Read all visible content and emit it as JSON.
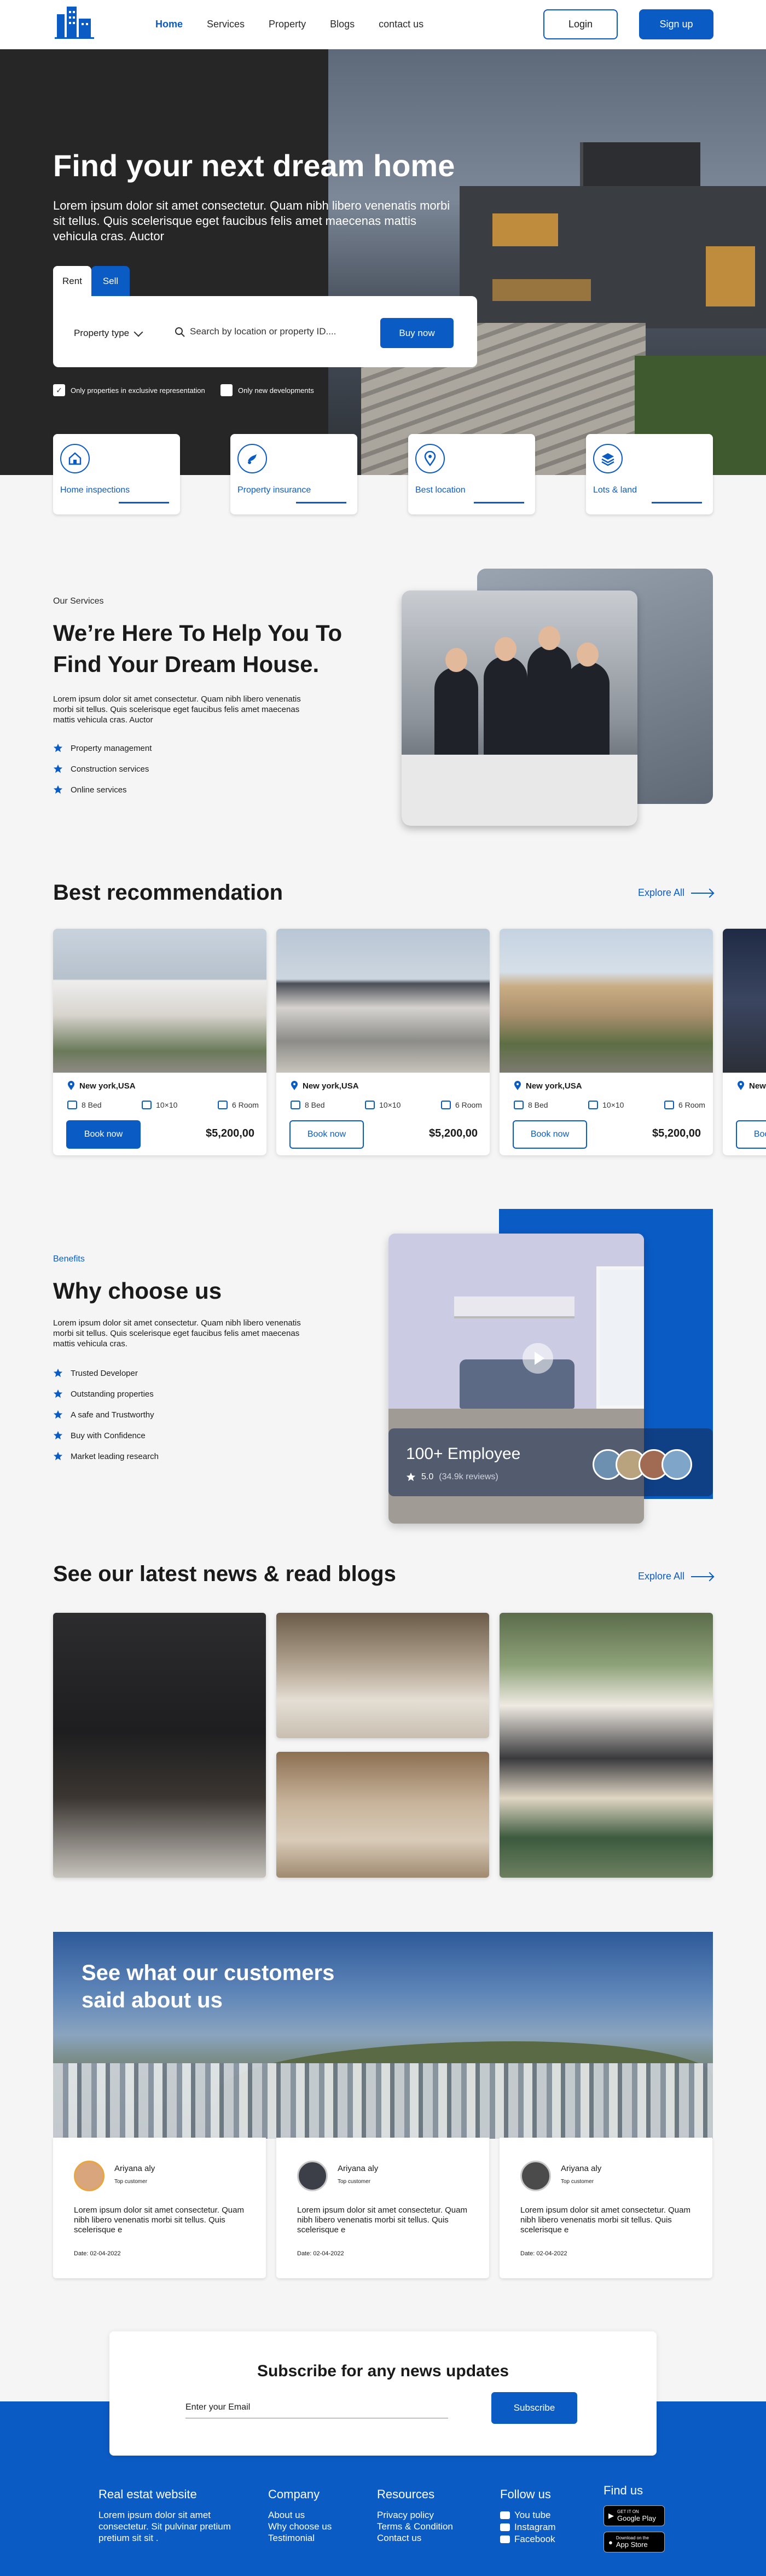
{
  "nav": {
    "links": [
      "Home",
      "Services",
      "Property",
      "Blogs",
      "contact us"
    ],
    "login": "Login",
    "signup": "Sign up"
  },
  "hero": {
    "title": "Find your next dream home",
    "subtitle": "Lorem ipsum dolor sit amet consectetur. Quam nibh libero venenatis morbi sit tellus. Quis scelerisque eget faucibus felis amet maecenas mattis vehicula cras. Auctor",
    "tabs": [
      "Rent",
      "Sell"
    ],
    "property_type": "Property type",
    "search_placeholder": "Search by location or property ID....",
    "buy_button": "Buy now",
    "checkbox_1": "Only properties in exclusive representation",
    "checkbox_2": "Only new developments"
  },
  "features": [
    "Home inspections",
    "Property insurance",
    "Best location",
    "Lots & land"
  ],
  "services": {
    "kicker": "Our Services",
    "title": "We’re Here To Help You To Find Your Dream House.",
    "text": "Lorem ipsum dolor sit amet consectetur. Quam nibh libero venenatis morbi sit tellus. Quis scelerisque eget faucibus felis amet maecenas mattis vehicula cras. Auctor",
    "items": [
      "Property management",
      "Construction services",
      "Online services"
    ]
  },
  "recommendation": {
    "title": "Best recommendation",
    "explore": "Explore All",
    "cards": [
      {
        "location": "New york,USA",
        "bed": "8 Bed",
        "size": "10×10",
        "rooms": "6 Room",
        "book": "Book now",
        "price": "$5,200,00"
      },
      {
        "location": "New york,USA",
        "bed": "8 Bed",
        "size": "10×10",
        "rooms": "6 Room",
        "book": "Book now",
        "price": "$5,200,00"
      },
      {
        "location": "New york,USA",
        "bed": "8 Bed",
        "size": "10×10",
        "rooms": "6 Room",
        "book": "Book now",
        "price": "$5,200,00"
      },
      {
        "location": "New york,USA",
        "bed": "",
        "size": "",
        "rooms": "",
        "book": "Book now",
        "price": ""
      }
    ]
  },
  "why": {
    "kicker": "Benefits",
    "title": "Why choose us",
    "text": "Lorem ipsum dolor sit amet consectetur. Quam nibh libero venenatis morbi sit tellus. Quis scelerisque eget faucibus felis amet maecenas mattis vehicula cras.",
    "items": [
      "Trusted Developer",
      "Outstanding properties",
      "A safe and Trustworthy",
      "Buy with Confidence",
      "Market leading research"
    ],
    "employee_title": "100+ Employee",
    "rating": "5.0",
    "reviews": "(34.9k reviews)"
  },
  "blogs": {
    "title": "See our latest news & read blogs",
    "explore": "Explore All"
  },
  "testimonials": {
    "title": "See what our customers said about us",
    "cards": [
      {
        "name": "Ariyana  aly",
        "role": "Top customer",
        "text": "Lorem ipsum dolor sit amet consectetur. Quam nibh libero venenatis morbi sit tellus. Quis scelerisque e",
        "date": "Date: 02-04-2022"
      },
      {
        "name": "Ariyana  aly",
        "role": "Top customer",
        "text": "Lorem ipsum dolor sit amet consectetur. Quam nibh libero venenatis morbi sit tellus. Quis scelerisque e",
        "date": "Date: 02-04-2022"
      },
      {
        "name": "Ariyana  aly",
        "role": "Top customer",
        "text": "Lorem ipsum dolor sit amet consectetur. Quam nibh libero venenatis morbi sit tellus. Quis scelerisque e",
        "date": "Date: 02-04-2022"
      }
    ]
  },
  "subscribe": {
    "title": "Subscribe for any news updates",
    "placeholder": "Enter your Email",
    "button": "Subscribe"
  },
  "footer": {
    "brand_title": "Real estat website",
    "brand_text": "Lorem ipsum dolor sit amet consectetur. Sit pulvinar pretium pretium sit sit .",
    "company_title": "Company",
    "company_items": [
      "About us",
      "Why choose us",
      "Testimonial"
    ],
    "resources_title": "Resources",
    "resources_items": [
      "Privacy policy",
      "Terms & Condition",
      "Contact us"
    ],
    "follow_title": "Follow us",
    "follow_items": [
      "You tube",
      "Instagram",
      "Facebook"
    ],
    "find_title": "Find us",
    "store_1_small": "GET IT ON",
    "store_1": "Google Play",
    "store_2_small": "Download on the",
    "store_2": "App Store"
  },
  "colors": {
    "accent": "#0a5bc4"
  }
}
